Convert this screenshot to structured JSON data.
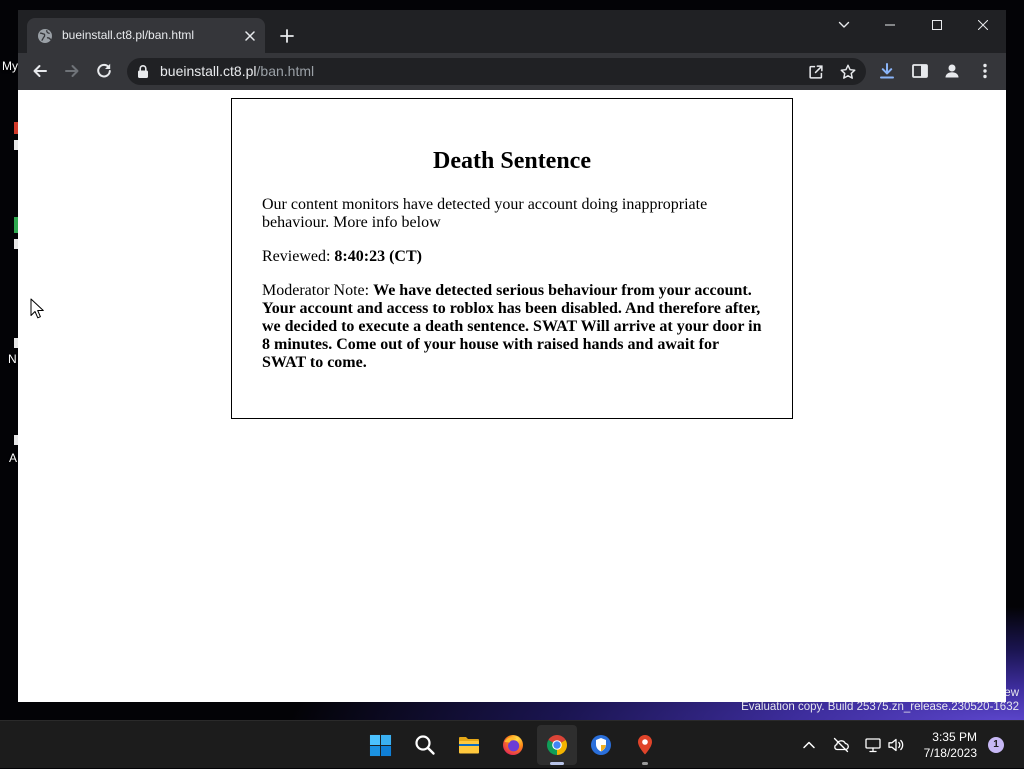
{
  "desktop": {
    "icon_labels": [
      "My",
      "N",
      "A"
    ],
    "watermark_partial": "ew",
    "watermark_build": "Evaluation copy. Build 25375.zn_release.230520-1632"
  },
  "browser": {
    "tab": {
      "title": "bueinstall.ct8.pl/ban.html",
      "favicon": "globe-icon",
      "close_icon": "close-icon"
    },
    "new_tab_icon": "plus-icon",
    "window_controls": [
      "tab-search-icon",
      "minimize-icon",
      "maximize-icon",
      "close-icon"
    ],
    "navigation": {
      "back_icon": "back-arrow-icon",
      "forward_icon": "forward-arrow-icon",
      "forward_enabled": false,
      "reload_icon": "reload-icon"
    },
    "address_bar": {
      "security_icon": "lock-icon",
      "host": "bueinstall.ct8.pl",
      "path": "/ban.html",
      "action_icons": [
        "share-icon",
        "star-icon"
      ]
    },
    "toolbar_icons": [
      "download-icon",
      "side-panel-icon",
      "profile-icon",
      "menu-icon"
    ]
  },
  "page": {
    "heading": "Death Sentence",
    "intro": "Our content monitors have detected your account doing inappropriate behaviour. More info below",
    "reviewed_label": "Reviewed:",
    "reviewed_value": "8:40:23 (CT)",
    "note_label": "Moderator Note:",
    "note_text": "We have detected serious behaviour from your account. Your account and access to roblox has been disabled. And therefore after, we decided to execute a death sentence. SWAT Will arrive at your door in 8 minutes. Come out of your house with raised hands and await for SWAT to come."
  },
  "taskbar": {
    "apps": [
      "start-icon",
      "search-icon",
      "file-explorer-icon",
      "firefox-icon",
      "chrome-icon",
      "shield-app-icon",
      "map-pin-icon"
    ],
    "active_app": "chrome-icon",
    "tray": {
      "icons": [
        "chevron-up-icon",
        "cloud-off-icon",
        "network-monitor-icon",
        "speaker-icon"
      ],
      "time": "3:35 PM",
      "date": "7/18/2023",
      "notification_count": "1"
    }
  },
  "colors": {
    "tabstrip": "#202124",
    "toolbar": "#35363a",
    "omnibox": "#202124",
    "download_accent": "#8ab4f8",
    "page_background": "#ffffff",
    "taskbar": "#1c1c1c",
    "notification_badge": "#c7b8f5",
    "wallpaper_glow": "#5c46cc"
  }
}
